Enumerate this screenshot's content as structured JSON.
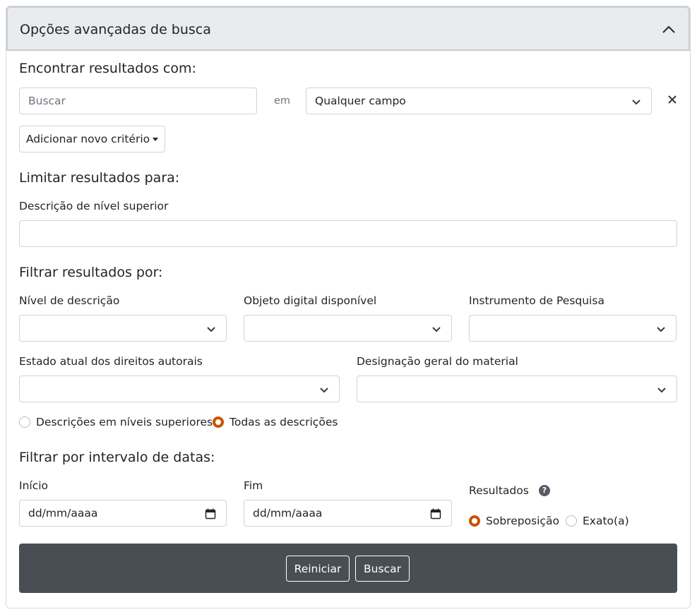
{
  "panel": {
    "title": "Opções avançadas de busca"
  },
  "find": {
    "heading": "Encontrar resultados com:",
    "search_placeholder": "Buscar",
    "in_label": "em",
    "field_selected": "Qualquer campo",
    "add_criterion_label": "Adicionar novo critério"
  },
  "limit": {
    "heading": "Limitar resultados para:",
    "top_level_label": "Descrição de nível superior",
    "top_level_value": ""
  },
  "filter": {
    "heading": "Filtrar resultados por:",
    "level_label": "Nível de descrição",
    "level_value": "",
    "digital_object_label": "Objeto digital disponível",
    "digital_object_value": "",
    "finding_aid_label": "Instrumento de Pesquisa",
    "finding_aid_value": "",
    "copyright_label": "Estado atual dos direitos autorais",
    "copyright_value": "",
    "material_label": "Designação geral do material",
    "material_value": "",
    "scope_options": [
      {
        "label": "Descrições em níveis superiores",
        "checked": false
      },
      {
        "label": "Todas as descrições",
        "checked": true
      }
    ]
  },
  "dates": {
    "heading": "Filtrar por intervalo de datas:",
    "start_label": "Início",
    "start_value": "dd/mm/aaaa",
    "end_label": "Fim",
    "end_value": "dd/mm/aaaa",
    "results_label": "Resultados",
    "help_glyph": "?",
    "result_options": [
      {
        "label": "Sobreposição",
        "checked": true
      },
      {
        "label": "Exato(a)",
        "checked": false
      }
    ]
  },
  "footer": {
    "reset_label": "Reiniciar",
    "search_label": "Buscar"
  },
  "colors": {
    "accent": "#c85200",
    "footer_bg": "#494e54",
    "header_bg": "#e9ecef"
  },
  "icons": {
    "collapse": "chevron-up-icon",
    "select": "chevron-down-icon",
    "remove": "close-icon",
    "calendar": "calendar-icon",
    "help": "question-circle-icon"
  }
}
